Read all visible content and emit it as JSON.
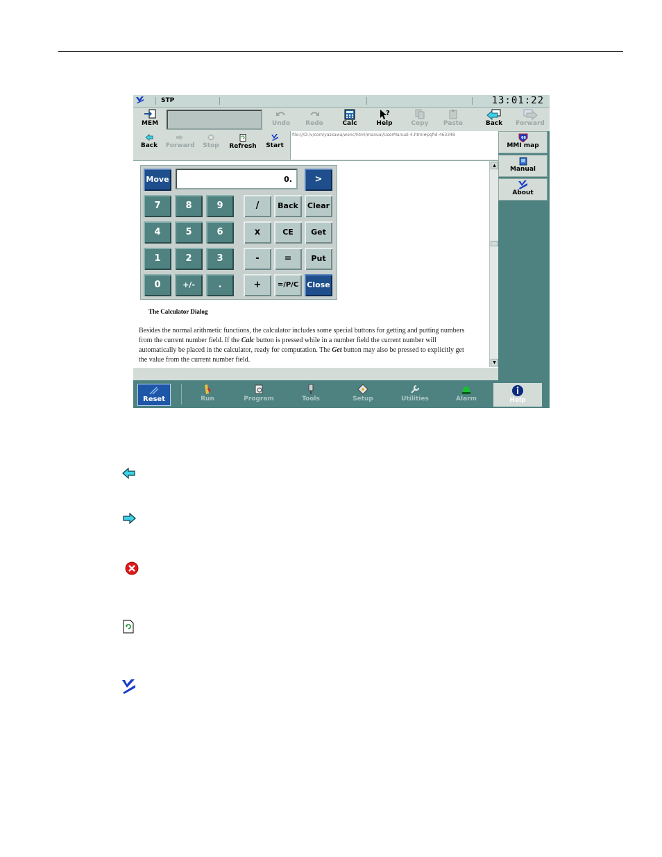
{
  "statusbar": {
    "mode": "STP",
    "time": "13:01:22"
  },
  "toolbar": {
    "mem_label": "MEM",
    "undo_label": "Undo",
    "redo_label": "Redo",
    "calc_label": "Calc",
    "help_label": "Help",
    "copy_label": "Copy",
    "paste_label": "Paste",
    "back_label": "Back",
    "forward_label": "Forward"
  },
  "browser": {
    "back_label": "Back",
    "forward_label": "Forward",
    "stop_label": "Stop",
    "refresh_label": "Refresh",
    "start_label": "Start",
    "url": "file:///D:/v/com/yaskawa/wenc/html/manual/UserManual-4.html#pgfId-463348"
  },
  "sidebar": {
    "mmi_map_label": "MMI map",
    "manual_label": "Manual",
    "about_label": "About"
  },
  "calculator": {
    "move_label": "Move",
    "display_value": "0.",
    "arrow_label": ">",
    "keys": {
      "k7": "7",
      "k8": "8",
      "k9": "9",
      "k4": "4",
      "k5": "5",
      "k6": "6",
      "k1": "1",
      "k2": "2",
      "k3": "3",
      "k0": "0",
      "plusminus": "+/-",
      "dot": ".",
      "div": "/",
      "mul": "x",
      "sub": "-",
      "add": "+",
      "back": "Back",
      "ce": "CE",
      "eq": "=",
      "pct": "=/P/C",
      "clear": "Clear",
      "get": "Get",
      "put": "Put",
      "close": "Close"
    }
  },
  "content": {
    "caption": "The Calculator Dialog",
    "para_1": "Besides the normal arithmetic functions, the calculator includes some special buttons for getting and putting numbers from the current number field. If the ",
    "para_calc": "Calc",
    "para_2": " button is pressed while in a number field the current number will automatically be placed in the calculator, ready for computation. The ",
    "para_get": "Get",
    "para_3": " button may also be pressed to explicitly get the value from the current number field."
  },
  "bottombar": {
    "reset_label": "Reset",
    "run_label": "Run",
    "program_label": "Program",
    "tools_label": "Tools",
    "setup_label": "Setup",
    "utilities_label": "Utilities",
    "alarm_label": "Alarm",
    "help_label": "Help"
  },
  "icons": {
    "back": "back-arrow-icon",
    "forward": "forward-arrow-icon",
    "stop": "stop-icon",
    "refresh": "refresh-icon",
    "start": "start-logo-icon"
  },
  "colors": {
    "panel_teal": "#4e8281",
    "key_teal": "#4f8280",
    "key_blue": "#1e4e8c",
    "toolbar_gray": "#d4dcd8",
    "arrow_cyan": "#3fd0e8"
  }
}
